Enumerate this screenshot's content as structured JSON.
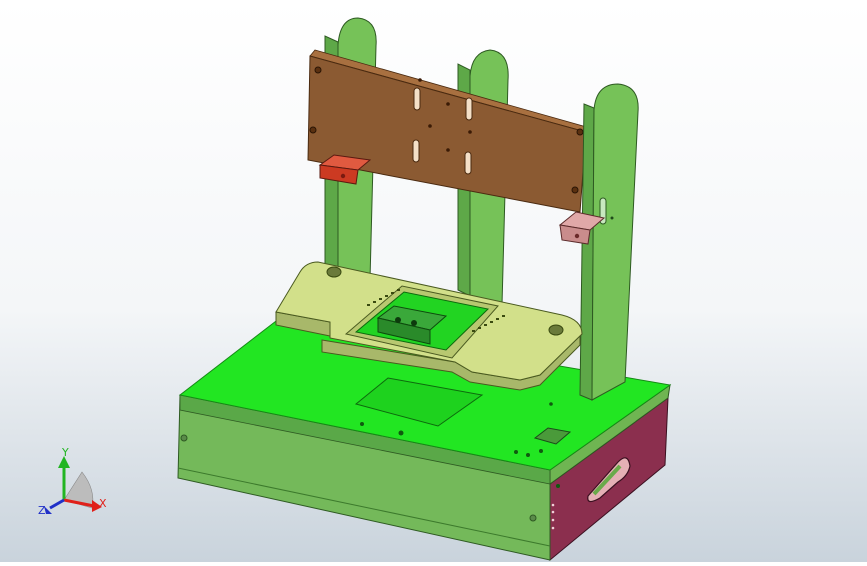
{
  "triad": {
    "x_label": "X",
    "y_label": "Y",
    "z_label": "Z"
  },
  "colors": {
    "background_top": "#ffffff",
    "background_bottom": "#c9d3dc",
    "base_top": "#22e622",
    "base_front": "#74b95a",
    "base_side_panel": "#8b2f4e",
    "pillar": "#76c258",
    "top_plate": "#8b5a32",
    "fixture_plate": "#d2e08a",
    "red_block": "#cc3a22",
    "pink_block": "#c98c8c",
    "axis_x": "#e0201a",
    "axis_y": "#22b522",
    "axis_z": "#2030c8"
  }
}
